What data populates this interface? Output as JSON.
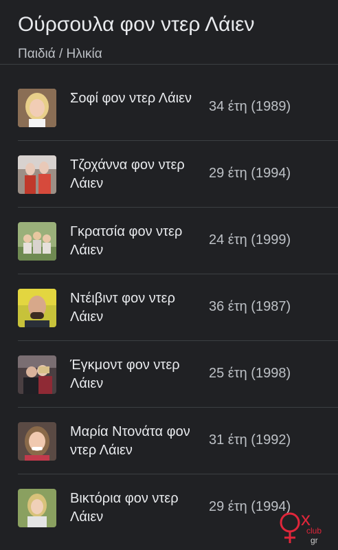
{
  "header": {
    "title": "Ούρσουλα φον ντερ Λάιεν",
    "subtitle": "Παιδιά / Ηλικία"
  },
  "children": [
    {
      "name": "Σοφί φον ντερ Λάιεν",
      "age": "34 έτη (1989)"
    },
    {
      "name": "Τζοχάννα φον ντερ Λάιεν",
      "age": "29 έτη (1994)"
    },
    {
      "name": "Γκρατσία φον ντερ Λάιεν",
      "age": "24 έτη (1999)"
    },
    {
      "name": "Ντέιβιντ φον ντερ Λάιεν",
      "age": "36 έτη (1987)"
    },
    {
      "name": "Έγκμοντ φον ντερ Λάιεν",
      "age": "25 έτη (1998)"
    },
    {
      "name": "Μαρία Ντονάτα φον ντερ Λάιεν",
      "age": "31 έτη (1992)"
    },
    {
      "name": "Βικτόρια φον ντερ Λάιεν",
      "age": "29 έτη (1994)"
    }
  ],
  "watermark": {
    "letter": "x",
    "word": "club",
    "suffix": "gr",
    "color": "#e0263a"
  },
  "icons": [
    "person-photo-icon",
    "watermark-logo"
  ]
}
